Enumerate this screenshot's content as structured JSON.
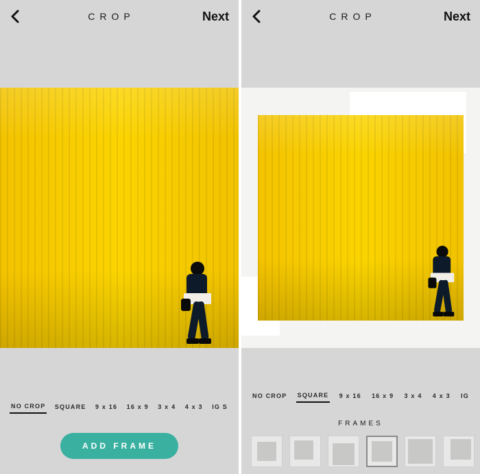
{
  "left": {
    "title": "CROP",
    "next": "Next",
    "ratios": [
      "NO CROP",
      "SQUARE",
      "9 x 16",
      "16 x 9",
      "3 x 4",
      "4 x 3",
      "IG S"
    ],
    "selected_ratio_index": 0,
    "add_frame_label": "ADD FRAME"
  },
  "right": {
    "title": "CROP",
    "next": "Next",
    "ratios": [
      "NO CROP",
      "SQUARE",
      "9 x 16",
      "16 x 9",
      "3 x 4",
      "4 x 3",
      "IG"
    ],
    "selected_ratio_index": 1,
    "frames_label": "FRAMES",
    "selected_frame_index": 3
  },
  "colors": {
    "accent_button": "#3ab0a1",
    "yellow_wall": "#fbd400",
    "page_bg": "#d6d6d6"
  }
}
